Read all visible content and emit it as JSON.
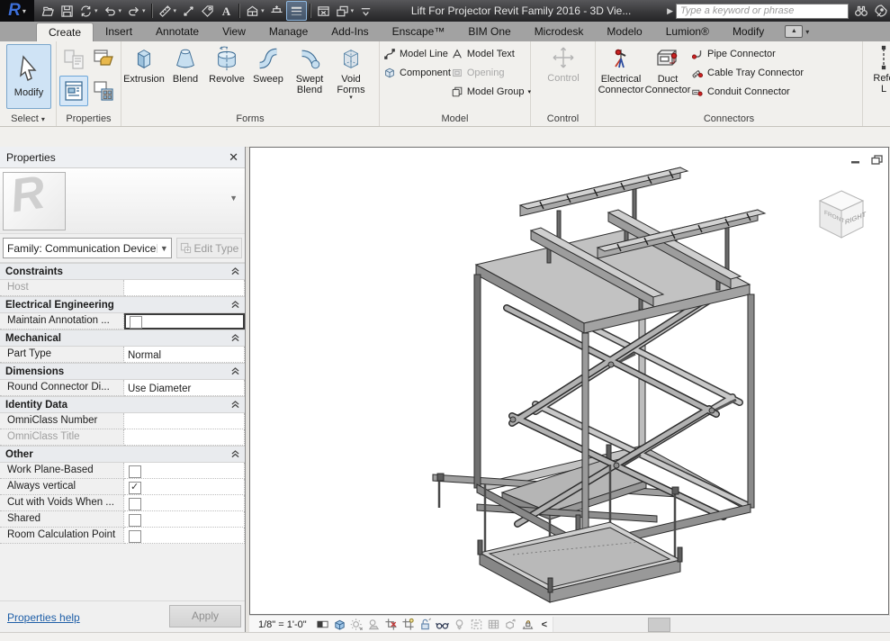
{
  "window": {
    "title": "Lift For Projector Revit Family 2016 - 3D Vie...",
    "search_placeholder": "Type a keyword or phrase"
  },
  "qat": [
    {
      "icon": "open"
    },
    {
      "icon": "save"
    },
    {
      "icon": "sync",
      "dropdown": true
    },
    {
      "icon": "undo",
      "dropdown": true
    },
    {
      "icon": "redo",
      "dropdown": true
    },
    {
      "sep": true
    },
    {
      "icon": "measure",
      "dropdown": true
    },
    {
      "icon": "aligned-dim"
    },
    {
      "icon": "tag"
    },
    {
      "icon": "text"
    },
    {
      "sep": true
    },
    {
      "icon": "view-3d",
      "dropdown": true
    },
    {
      "icon": "section"
    },
    {
      "icon": "thin-lines",
      "active": true
    },
    {
      "sep": true
    },
    {
      "icon": "close-hidden"
    },
    {
      "icon": "switch-windows",
      "dropdown": true
    },
    {
      "icon": "customize"
    }
  ],
  "tabs": [
    {
      "label": "Create",
      "active": true
    },
    {
      "label": "Insert"
    },
    {
      "label": "Annotate"
    },
    {
      "label": "View"
    },
    {
      "label": "Manage"
    },
    {
      "label": "Add-Ins"
    },
    {
      "label": "Enscape™"
    },
    {
      "label": "BIM One"
    },
    {
      "label": "Microdesk"
    },
    {
      "label": "Modelo"
    },
    {
      "label": "Lumion®"
    },
    {
      "label": "Modify"
    }
  ],
  "ribbon": {
    "select_panel": {
      "name": "Select",
      "modify_label": "Modify"
    },
    "properties_panel": {
      "name": "Properties"
    },
    "forms_panel": {
      "name": "Forms",
      "items": [
        {
          "icon": "extrusion",
          "label": "Extrusion"
        },
        {
          "icon": "blend",
          "label": "Blend"
        },
        {
          "icon": "revolve",
          "label": "Revolve"
        },
        {
          "icon": "sweep",
          "label": "Sweep"
        },
        {
          "icon": "swept-blend",
          "label": "Swept Blend"
        },
        {
          "icon": "void-forms",
          "label": "Void Forms",
          "dropdown": true
        }
      ]
    },
    "model_panel": {
      "name": "Model",
      "model_line": "Model Line",
      "component": "Component",
      "model_text": "Model Text",
      "opening": "Opening",
      "model_group": "Model Group"
    },
    "control_panel": {
      "name": "Control",
      "control_label": "Control"
    },
    "connectors_panel": {
      "name": "Connectors",
      "electrical": "Electrical Connector",
      "duct": "Duct Connector",
      "items": [
        {
          "icon": "pipe-connector",
          "label": "Pipe Connector"
        },
        {
          "icon": "cable-tray-connector",
          "label": "Cable Tray Connector"
        },
        {
          "icon": "conduit-connector",
          "label": "Conduit Connector"
        }
      ]
    },
    "datum_panel": {
      "label_line1": "Refe",
      "label_line2": "L"
    }
  },
  "palette": {
    "title": "Properties",
    "family_selector": "Family: Communication Device",
    "edit_type": "Edit Type",
    "groups": [
      {
        "header": "Constraints",
        "rows": [
          {
            "label": "Host",
            "text": true,
            "value": "",
            "disabled": true
          }
        ]
      },
      {
        "header": "Electrical Engineering",
        "rows": [
          {
            "label": "Maintain Annotation ...",
            "checkbox": true,
            "focused": true
          }
        ]
      },
      {
        "header": "Mechanical",
        "rows": [
          {
            "label": "Part Type",
            "text": true,
            "value": "Normal"
          }
        ]
      },
      {
        "header": "Dimensions",
        "rows": [
          {
            "label": "Round Connector Di...",
            "text": true,
            "value": "Use Diameter"
          }
        ]
      },
      {
        "header": "Identity Data",
        "rows": [
          {
            "label": "OmniClass Number",
            "text": true,
            "value": ""
          },
          {
            "label": "OmniClass Title",
            "text": true,
            "value": "",
            "disabled": true
          }
        ]
      },
      {
        "header": "Other",
        "rows": [
          {
            "label": "Work Plane-Based",
            "checkbox": true
          },
          {
            "label": "Always vertical",
            "checkbox": true,
            "checked": true
          },
          {
            "label": "Cut with Voids When ...",
            "checkbox": true
          },
          {
            "label": "Shared",
            "checkbox": true
          },
          {
            "label": "Room Calculation Point",
            "checkbox": true
          }
        ]
      }
    ],
    "help_link": "Properties help",
    "apply_label": "Apply"
  },
  "canvas": {
    "viewcube": {
      "right": "RIGHT",
      "front": "FRONT"
    }
  },
  "viewbar": {
    "scale": "1/8\" = 1'-0\"",
    "icons": [
      {
        "icon": "vb-detail"
      },
      {
        "icon": "vb-style"
      },
      {
        "icon": "vb-sun"
      },
      {
        "icon": "vb-shadow"
      },
      {
        "icon": "vb-crop"
      },
      {
        "icon": "vb-cropvis"
      },
      {
        "icon": "vb-lock"
      },
      {
        "icon": "vb-glasses"
      },
      {
        "icon": "vb-bulb"
      },
      {
        "icon": "vb-tvp"
      },
      {
        "icon": "vb-grid"
      },
      {
        "icon": "vb-disp"
      },
      {
        "icon": "vb-constraints"
      }
    ],
    "collapse": "<"
  }
}
